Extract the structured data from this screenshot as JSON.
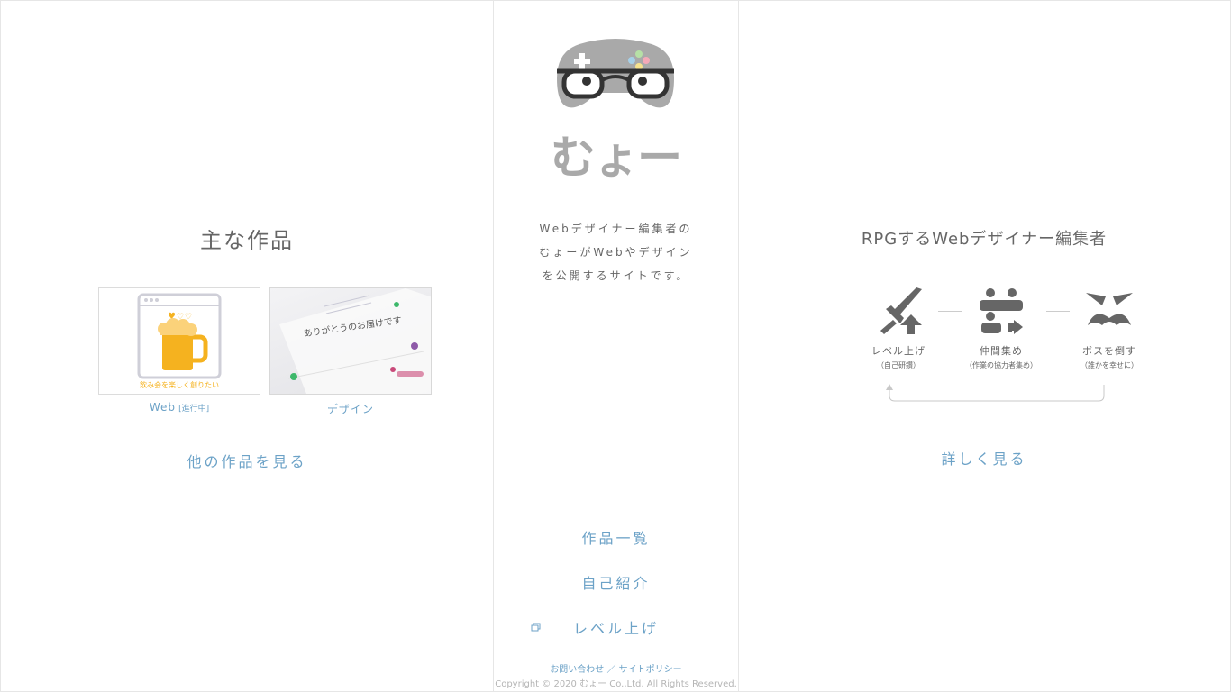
{
  "brand": {
    "name": "むょー"
  },
  "left": {
    "section_title": "主な作品",
    "works": [
      {
        "label": "Web",
        "tag": "[進行中]",
        "thumb_caption": "飲み会を楽しく創りたい"
      },
      {
        "label": "デザイン",
        "thumb_caption": "ありがとうのお届けです"
      }
    ],
    "more_link": "他の作品を見る"
  },
  "center": {
    "intro_lines": [
      "Webデザイナー編集者の",
      "むょーがWebやデザイン",
      "を公開するサイトです。"
    ],
    "nav": {
      "works": "作品一覧",
      "about": "自己紹介",
      "level_up": "レベル上げ"
    },
    "footer": {
      "links": "お問い合わせ ／ サイトポリシー",
      "copyright": "Copyright © 2020 むょー Co.,Ltd. All Rights Reserved."
    }
  },
  "right": {
    "tagline": "RPGするWebデザイナー編集者",
    "steps": [
      {
        "label": "レベル上げ",
        "sub": "（自己研鑽）",
        "icon": "sword-level-up-icon"
      },
      {
        "label": "仲間集め",
        "sub": "（作業の協力者集め）",
        "icon": "party-members-icon"
      },
      {
        "label": "ボスを倒す",
        "sub": "（誰かを幸せに）",
        "icon": "boss-face-icon"
      }
    ],
    "detail_link": "詳しく見る"
  },
  "colors": {
    "link": "#6ca2c7",
    "text": "#666666",
    "icon": "#666666",
    "logo_gray": "#a9a9a9",
    "beer": "#f5b21f",
    "border": "#e6e6e6"
  }
}
